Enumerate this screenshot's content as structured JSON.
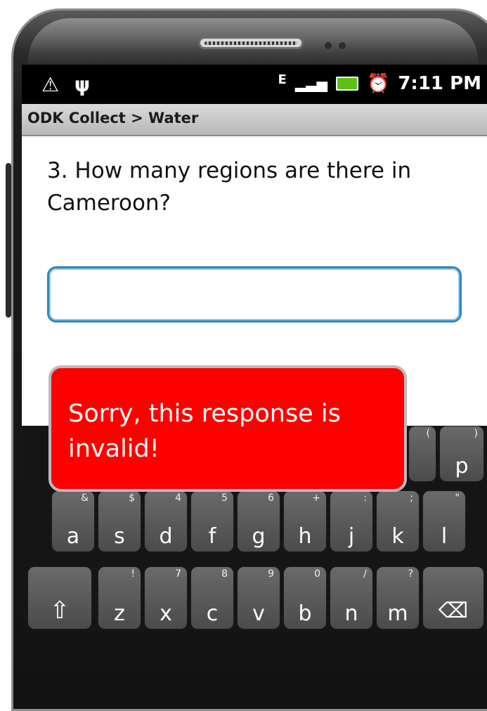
{
  "status_bar": {
    "time": "7:11 PM",
    "network_label": "E"
  },
  "app_bar": {
    "title": "ODK Collect > Water"
  },
  "question": {
    "text": "3. How many regions are there in Cameroon?"
  },
  "answer": {
    "value": ""
  },
  "toast": {
    "message": "Sorry, this response is invalid!"
  },
  "keyboard": {
    "row1_partial": [
      {
        "top": "(",
        "main": ""
      },
      {
        "top": ")",
        "main": "p"
      }
    ],
    "row2": [
      {
        "top": "&",
        "main": "a"
      },
      {
        "top": "$",
        "main": "s"
      },
      {
        "top": "4",
        "main": "d"
      },
      {
        "top": "5",
        "main": "f"
      },
      {
        "top": "6",
        "main": "g"
      },
      {
        "top": "+",
        "main": "h"
      },
      {
        "top": ":",
        "main": "j"
      },
      {
        "top": ";",
        "main": "k"
      },
      {
        "top": "\"",
        "main": "l"
      }
    ],
    "row3": [
      {
        "top": "!",
        "main": "z"
      },
      {
        "top": "7",
        "main": "x"
      },
      {
        "top": "8",
        "main": "c"
      },
      {
        "top": "9",
        "main": "v"
      },
      {
        "top": "0",
        "main": "b"
      },
      {
        "top": "/",
        "main": "n"
      },
      {
        "top": "?",
        "main": "m"
      }
    ],
    "shift_icon": "shift-icon",
    "backspace_icon": "backspace-icon"
  }
}
